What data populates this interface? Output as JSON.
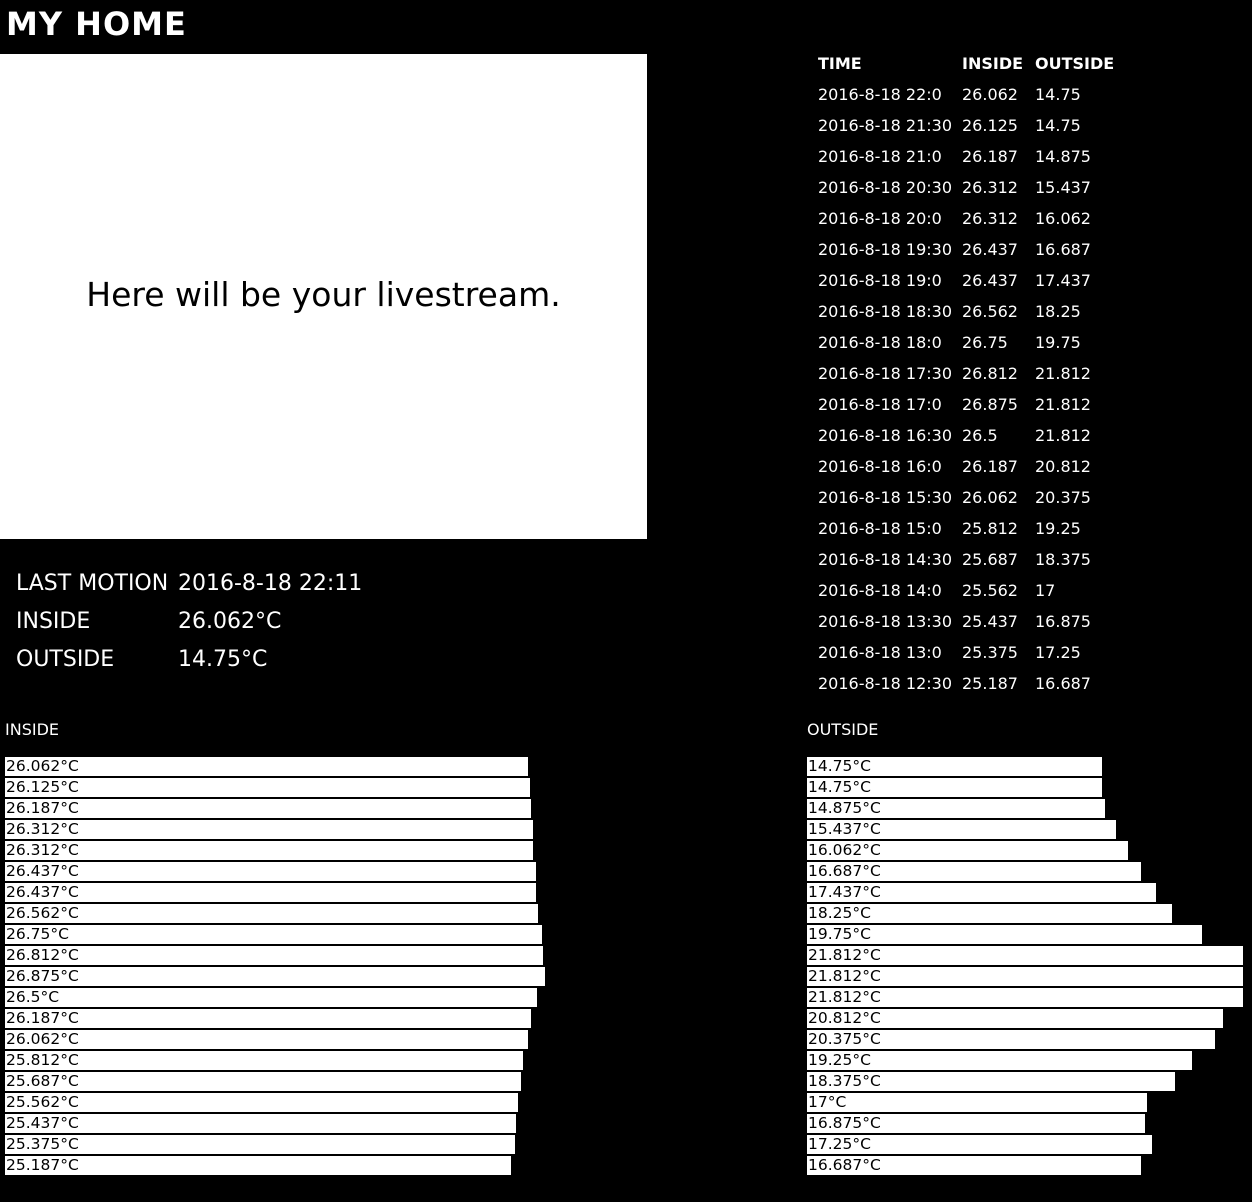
{
  "header": {
    "title": "MY HOME"
  },
  "livestream": {
    "placeholder": "Here will be your livestream."
  },
  "status": {
    "last_motion_label": "LAST MOTION",
    "last_motion_value": "2016-8-18 22:11",
    "inside_label": "INSIDE",
    "inside_value": "26.062°C",
    "outside_label": "OUTSIDE",
    "outside_value": "14.75°C"
  },
  "log": {
    "headers": [
      "TIME",
      "INSIDE",
      "OUTSIDE"
    ],
    "rows": [
      [
        "2016-8-18 22:0",
        "26.062",
        "14.75"
      ],
      [
        "2016-8-18 21:30",
        "26.125",
        "14.75"
      ],
      [
        "2016-8-18 21:0",
        "26.187",
        "14.875"
      ],
      [
        "2016-8-18 20:30",
        "26.312",
        "15.437"
      ],
      [
        "2016-8-18 20:0",
        "26.312",
        "16.062"
      ],
      [
        "2016-8-18 19:30",
        "26.437",
        "16.687"
      ],
      [
        "2016-8-18 19:0",
        "26.437",
        "17.437"
      ],
      [
        "2016-8-18 18:30",
        "26.562",
        "18.25"
      ],
      [
        "2016-8-18 18:0",
        "26.75",
        "19.75"
      ],
      [
        "2016-8-18 17:30",
        "26.812",
        "21.812"
      ],
      [
        "2016-8-18 17:0",
        "26.875",
        "21.812"
      ],
      [
        "2016-8-18 16:30",
        "26.5",
        "21.812"
      ],
      [
        "2016-8-18 16:0",
        "26.187",
        "20.812"
      ],
      [
        "2016-8-18 15:30",
        "26.062",
        "20.375"
      ],
      [
        "2016-8-18 15:0",
        "25.812",
        "19.25"
      ],
      [
        "2016-8-18 14:30",
        "25.687",
        "18.375"
      ],
      [
        "2016-8-18 14:0",
        "25.562",
        "17"
      ],
      [
        "2016-8-18 13:30",
        "25.437",
        "16.875"
      ],
      [
        "2016-8-18 13:0",
        "25.375",
        "17.25"
      ],
      [
        "2016-8-18 12:30",
        "25.187",
        "16.687"
      ]
    ]
  },
  "chart_data": [
    {
      "type": "bar",
      "title": "INSIDE",
      "orientation": "horizontal",
      "unit": "°C",
      "values": [
        26.062,
        26.125,
        26.187,
        26.312,
        26.312,
        26.437,
        26.437,
        26.562,
        26.75,
        26.812,
        26.875,
        26.5,
        26.187,
        26.062,
        25.812,
        25.687,
        25.562,
        25.437,
        25.375,
        25.187
      ],
      "labels": [
        "26.062°C",
        "26.125°C",
        "26.187°C",
        "26.312°C",
        "26.312°C",
        "26.437°C",
        "26.437°C",
        "26.562°C",
        "26.75°C",
        "26.812°C",
        "26.875°C",
        "26.5°C",
        "26.187°C",
        "26.062°C",
        "25.812°C",
        "25.687°C",
        "25.562°C",
        "25.437°C",
        "25.375°C",
        "25.187°C"
      ]
    },
    {
      "type": "bar",
      "title": "OUTSIDE",
      "orientation": "horizontal",
      "unit": "°C",
      "values": [
        14.75,
        14.75,
        14.875,
        15.437,
        16.062,
        16.687,
        17.437,
        18.25,
        19.75,
        21.812,
        21.812,
        21.812,
        20.812,
        20.375,
        19.25,
        18.375,
        17,
        16.875,
        17.25,
        16.687
      ],
      "labels": [
        "14.75°C",
        "14.75°C",
        "14.875°C",
        "15.437°C",
        "16.062°C",
        "16.687°C",
        "17.437°C",
        "18.25°C",
        "19.75°C",
        "21.812°C",
        "21.812°C",
        "21.812°C",
        "20.812°C",
        "20.375°C",
        "19.25°C",
        "18.375°C",
        "17°C",
        "16.875°C",
        "17.25°C",
        "16.687°C"
      ]
    }
  ]
}
